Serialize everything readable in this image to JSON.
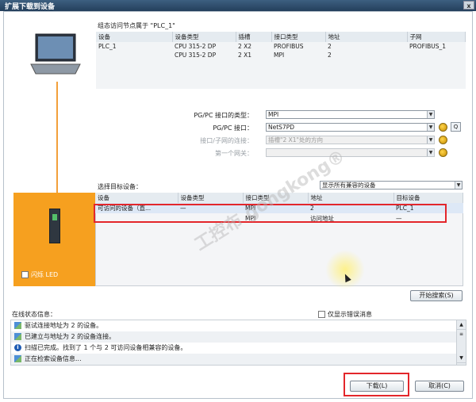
{
  "window": {
    "title": "扩展下载到设备",
    "close_label": "x"
  },
  "config_section": {
    "label": "组态访问节点属于 \"PLC_1\"",
    "columns": [
      "设备",
      "设备类型",
      "插槽",
      "接口类型",
      "地址",
      "子网"
    ],
    "rows": [
      [
        "PLC_1",
        "CPU 315-2 DP",
        "2 X2",
        "PROFIBUS",
        "2",
        "PROFIBUS_1"
      ],
      [
        "",
        "CPU 315-2 DP",
        "2 X1",
        "MPI",
        "2",
        ""
      ]
    ]
  },
  "interface_form": {
    "pgpc_type_label": "PG/PC 接口的类型：",
    "pgpc_type_value": "MPI",
    "pgpc_iface_label": "PG/PC 接口：",
    "pgpc_iface_value": "NetS7PD",
    "subnet_conn_label": "接口/子网的连接：",
    "subnet_conn_value": "插槽\"2 X1\"处的方向",
    "gateway_label": "第一个网关：",
    "gateway_value": ""
  },
  "target_section": {
    "label": "选择目标设备：",
    "filter_value": "显示所有兼容的设备",
    "columns": [
      "设备",
      "设备类型",
      "接口类型",
      "地址",
      "目标设备"
    ],
    "rows": [
      [
        "可访问的设备（直...",
        "—",
        "MPI",
        "2",
        "PLC_1"
      ],
      [
        "",
        "",
        "MPI",
        "访问地址",
        "—"
      ]
    ]
  },
  "flash_led_label": "闪烁 LED",
  "start_search_label": "开始搜索(S)",
  "status_section": {
    "label": "在线状态信息：",
    "errors_only_label": "仅显示错误消息",
    "messages": [
      {
        "icon": "network-icon",
        "text": "驱试连接地址为 2 的设备。"
      },
      {
        "icon": "network-icon",
        "text": "已建立与地址为 2 的设备连接。"
      },
      {
        "icon": "info-icon",
        "text": "扫描已完成。找到了 1 个与 2 可访问设备相兼容的设备。"
      },
      {
        "icon": "network-icon",
        "text": "正在检索设备信息..."
      }
    ]
  },
  "footer": {
    "download_label": "下载(L)",
    "cancel_label": "取消(C)"
  },
  "watermark": "工控布 gongkong®"
}
